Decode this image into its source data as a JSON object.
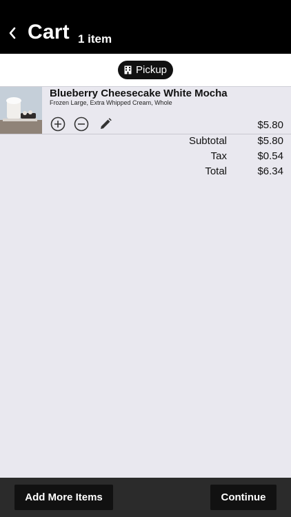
{
  "header": {
    "title": "Cart",
    "count": "1 item",
    "back_icon": "chevron-left-icon"
  },
  "order_mode": {
    "label": "Pickup",
    "icon": "building-icon"
  },
  "items": [
    {
      "name": "Blueberry Cheesecake White Mocha",
      "modifiers": "Frozen Large, Extra Whipped Cream, Whole",
      "price": "$5.80",
      "actions": [
        "plus-circle-icon",
        "minus-circle-icon",
        "pencil-icon"
      ]
    }
  ],
  "totals": [
    {
      "label": "Subtotal",
      "value": "$5.80"
    },
    {
      "label": "Tax",
      "value": "$0.54"
    },
    {
      "label": "Total",
      "value": "$6.34"
    }
  ],
  "footer": {
    "add_more_label": "Add More Items",
    "continue_label": "Continue"
  },
  "colors": {
    "header_bg": "#000000",
    "page_bg": "#e9e8ef",
    "footer_bg": "#2b2b2b",
    "button_bg": "#111111"
  }
}
